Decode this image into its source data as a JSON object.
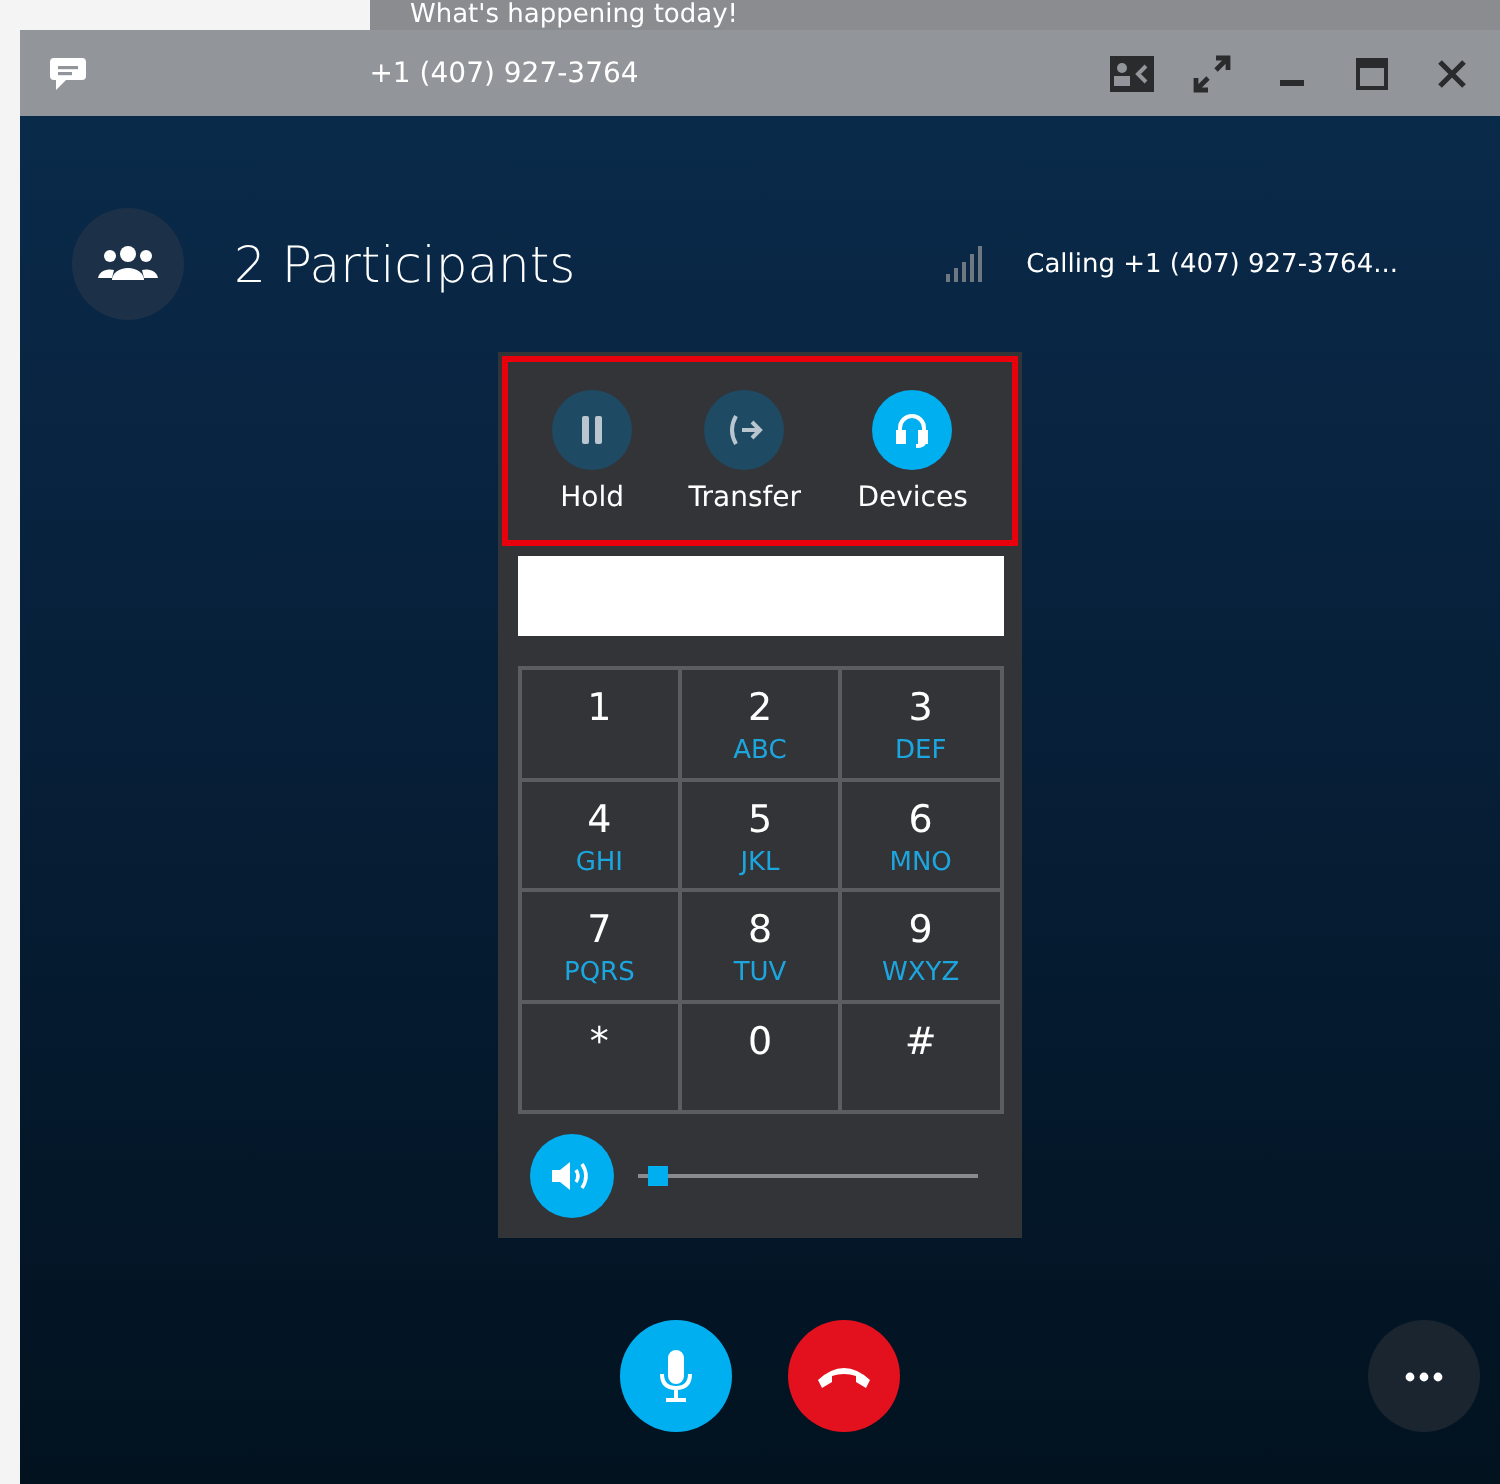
{
  "background_page": {
    "banner": "What's happening today!"
  },
  "window": {
    "title": "+1 (407) 927-3764"
  },
  "header": {
    "participants": "2 Participants",
    "status": "Calling +1 (407) 927-3764..."
  },
  "call_actions": [
    {
      "label": "Hold",
      "kind": "hold",
      "selected": false
    },
    {
      "label": "Transfer",
      "kind": "transfer",
      "selected": false
    },
    {
      "label": "Devices",
      "kind": "devices",
      "selected": true
    }
  ],
  "keypad": [
    {
      "digit": "1"
    },
    {
      "digit": "2",
      "letters": "ABC"
    },
    {
      "digit": "3",
      "letters": "DEF"
    },
    {
      "digit": "4",
      "letters": "GHI"
    },
    {
      "digit": "5",
      "letters": "JKL"
    },
    {
      "digit": "6",
      "letters": "MNO"
    },
    {
      "digit": "7",
      "letters": "PQRS"
    },
    {
      "digit": "8",
      "letters": "TUV"
    },
    {
      "digit": "9",
      "letters": "WXYZ"
    },
    {
      "digit": "*"
    },
    {
      "digit": "0"
    },
    {
      "digit": "#"
    }
  ],
  "volume": {
    "level": 0.03
  }
}
